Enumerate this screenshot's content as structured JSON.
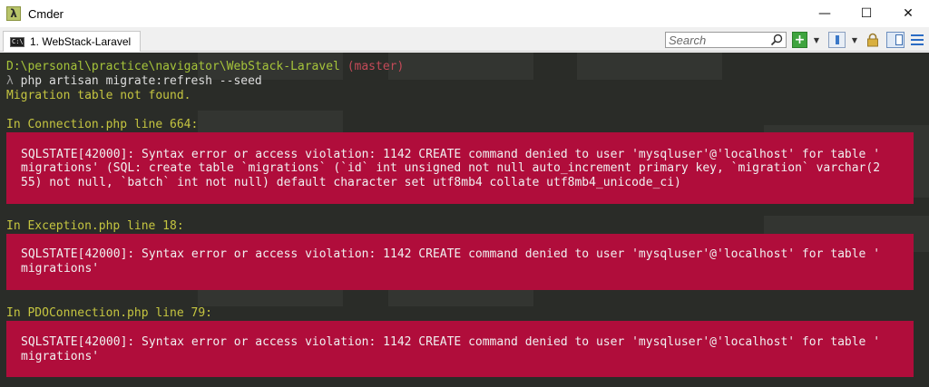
{
  "window": {
    "title": "Cmder",
    "app_icon": "λ",
    "controls": {
      "minimize": "—",
      "maximize": "☐",
      "close": "✕"
    }
  },
  "tabs": [
    {
      "label": "1. WebStack-Laravel",
      "icon": "console-icon",
      "icon_text": "C:\\"
    }
  ],
  "toolbar": {
    "search_placeholder": "Search",
    "new_tab": "+",
    "dropdown": "▼"
  },
  "console": {
    "prompt_path": "D:\\personal\\practice\\navigator\\WebStack-Laravel",
    "prompt_branch": "(master)",
    "prompt_symbol": "λ",
    "command": "php artisan migrate:refresh --seed",
    "output_line": "Migration table not found.",
    "sections": [
      {
        "header": "In Connection.php line 664:",
        "error_lines": [
          "SQLSTATE[42000]: Syntax error or access violation: 1142 CREATE command denied to user 'mysqluser'@'localhost' for table '",
          "migrations' (SQL: create table `migrations` (`id` int unsigned not null auto_increment primary key, `migration` varchar(2",
          "55) not null, `batch` int not null) default character set utf8mb4 collate utf8mb4_unicode_ci)"
        ]
      },
      {
        "header": "In Exception.php line 18:",
        "error_lines": [
          "SQLSTATE[42000]: Syntax error or access violation: 1142 CREATE command denied to user 'mysqluser'@'localhost' for table '",
          "migrations'"
        ]
      },
      {
        "header": "In PDOConnection.php line 79:",
        "error_lines": [
          "SQLSTATE[42000]: Syntax error or access violation: 1142 CREATE command denied to user 'mysqluser'@'localhost' for table '",
          "migrations'"
        ]
      }
    ]
  },
  "colors": {
    "console_bg": "#2a2c28",
    "path": "#a6c43a",
    "branch": "#c44a58",
    "header_yellow": "#c5c540",
    "error_bg": "#b00d3b",
    "error_text": "#f0f0f0"
  }
}
